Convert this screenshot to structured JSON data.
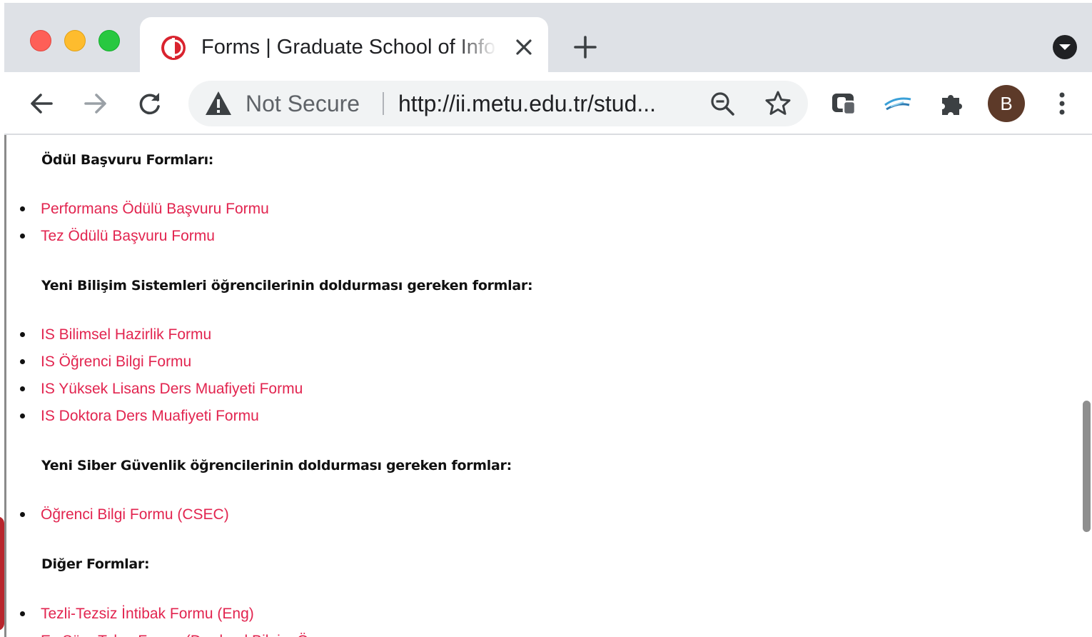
{
  "browser": {
    "tab": {
      "title": "Forms | Graduate School of Informatics"
    },
    "omnibox": {
      "security_label": "Not Secure",
      "url": "http://ii.metu.edu.tr/stud..."
    },
    "profile_initial": "B",
    "colors": {
      "tabstrip": "#dee1e6",
      "avatar": "#5d3a29",
      "favicon": "#d9232e"
    },
    "icons": [
      "back-arrow-icon",
      "forward-arrow-icon",
      "reload-icon",
      "warning-triangle-icon",
      "zoom-out-icon",
      "star-icon",
      "extension-icons",
      "puzzle-icon",
      "kebab-menu-icon"
    ]
  },
  "page": {
    "link_color": "#e2244f",
    "sections": [
      {
        "heading": "Ödül Başvuru Formları:",
        "items": [
          "Performans Ödülü Başvuru Formu",
          "Tez Ödülü Başvuru Formu"
        ]
      },
      {
        "heading": "Yeni Bilişim Sistemleri öğrencilerinin doldurması gereken formlar:",
        "items": [
          "IS Bilimsel Hazirlik Formu",
          "IS Öğrenci Bilgi Formu",
          "IS Yüksek Lisans Ders Muafiyeti Formu",
          "IS Doktora Ders Muafiyeti Formu"
        ]
      },
      {
        "heading": "Yeni Siber Güvenlik öğrencilerinin doldurması gereken formlar:",
        "items": [
          "Öğrenci Bilgi Formu (CSEC)"
        ]
      },
      {
        "heading": "Diğer Formlar:",
        "items": [
          "Tezli-Tezsiz İntibak Formu (Eng)",
          "Eş Süre Talep Formu (Durdurul Bilgi... Ön..."
        ]
      }
    ]
  }
}
